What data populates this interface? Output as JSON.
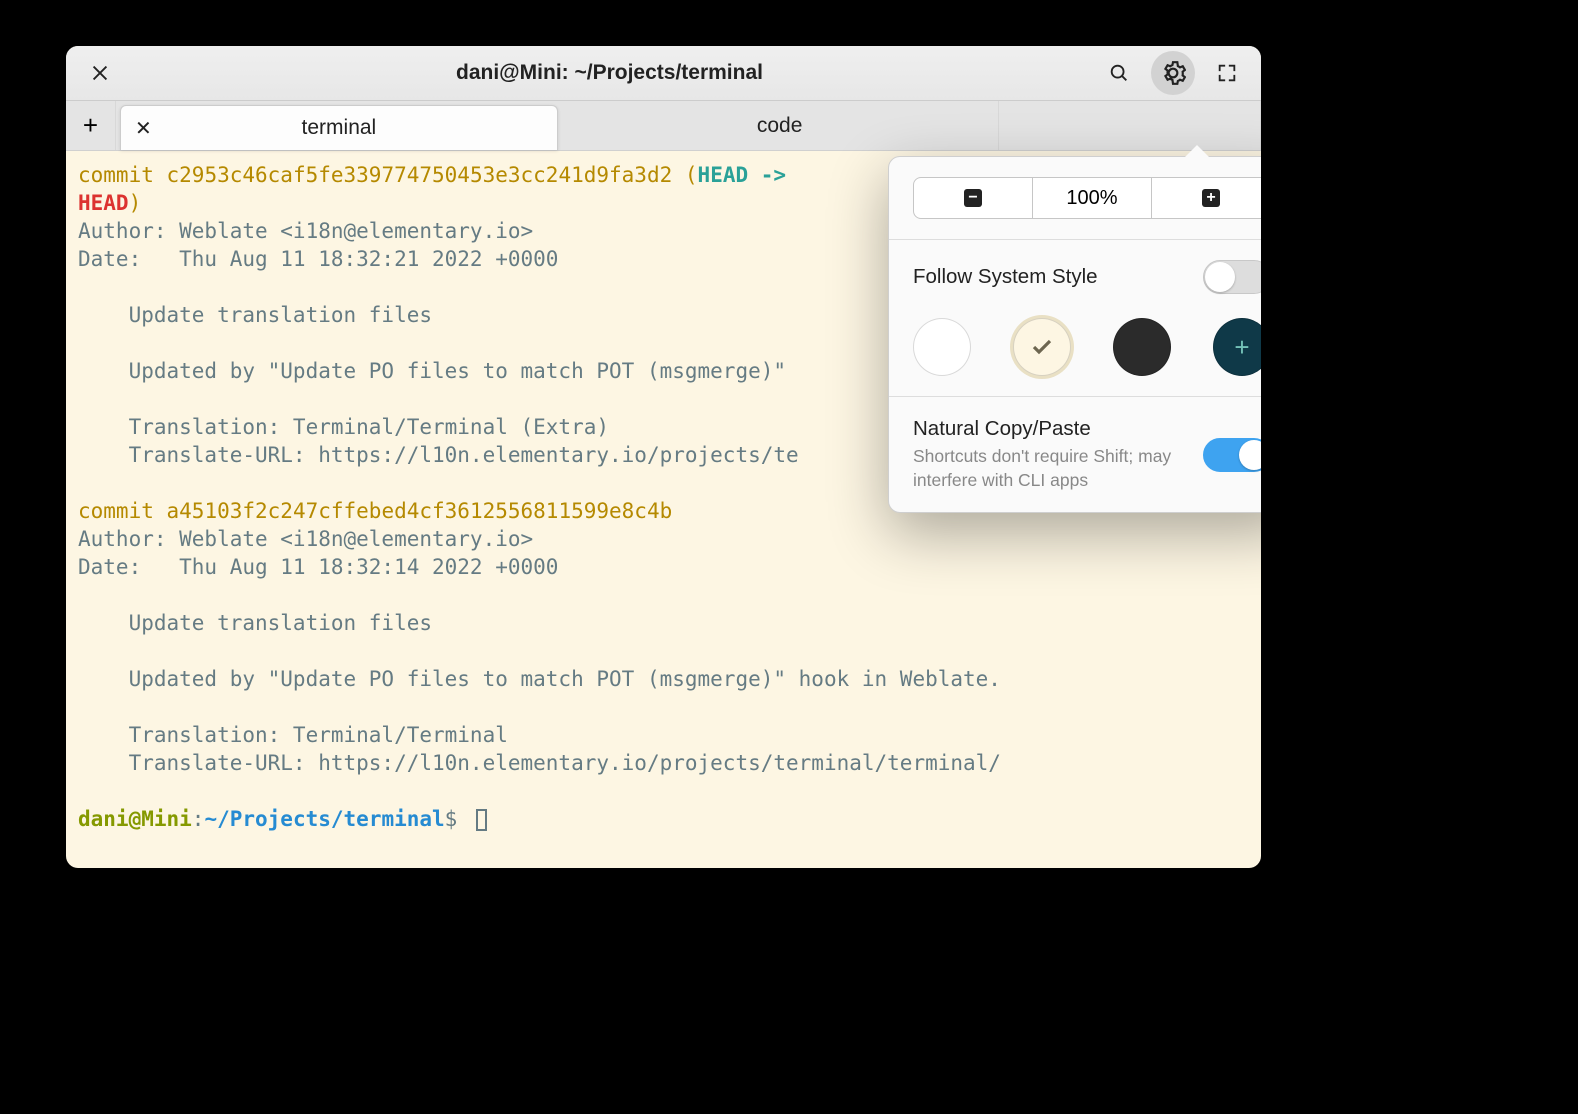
{
  "window": {
    "title": "dani@Mini: ~/Projects/terminal"
  },
  "tabs": [
    {
      "label": "terminal",
      "active": true
    },
    {
      "label": "code",
      "active": false
    },
    {
      "label": "",
      "active": false
    }
  ],
  "popover": {
    "zoom_level": "100%",
    "follow_system_style_label": "Follow System Style",
    "follow_system_style_on": false,
    "natural_copy_paste_label": "Natural Copy/Paste",
    "natural_copy_paste_desc": "Shortcuts don't require Shift; may interfere with CLI apps",
    "natural_copy_paste_on": true,
    "themes": [
      {
        "name": "light",
        "selected": false
      },
      {
        "name": "solarized",
        "selected": true
      },
      {
        "name": "dark",
        "selected": false
      },
      {
        "name": "custom",
        "selected": false
      }
    ]
  },
  "terminal": {
    "prompt_user": "dani@Mini",
    "prompt_colon": ":",
    "prompt_path": "~/Projects/terminal",
    "prompt_sigil": "$",
    "commits": [
      {
        "commit_word": "commit",
        "hash": "c2953c46caf5fe339774750453e3cc241d9fa3d2",
        "decor_open": " (",
        "decor_head": "HEAD -> ",
        "decor_head2": "HEAD",
        "decor_close": ")",
        "author": "Author: Weblate <i18n@elementary.io>",
        "date": "Date:   Thu Aug 11 18:32:21 2022 +0000",
        "body": [
          "    Update translation files",
          "",
          "    Updated by \"Update PO files to match POT (msgmerge)\"",
          "",
          "    Translation: Terminal/Terminal (Extra)",
          "    Translate-URL: https://l10n.elementary.io/projects/te"
        ]
      },
      {
        "commit_word": "commit",
        "hash": "a45103f2c247cffebed4cf3612556811599e8c4b",
        "author": "Author: Weblate <i18n@elementary.io>",
        "date": "Date:   Thu Aug 11 18:32:14 2022 +0000",
        "body": [
          "    Update translation files",
          "",
          "    Updated by \"Update PO files to match POT (msgmerge)\" hook in Weblate.",
          "",
          "    Translation: Terminal/Terminal",
          "    Translate-URL: https://l10n.elementary.io/projects/terminal/terminal/"
        ]
      }
    ]
  }
}
